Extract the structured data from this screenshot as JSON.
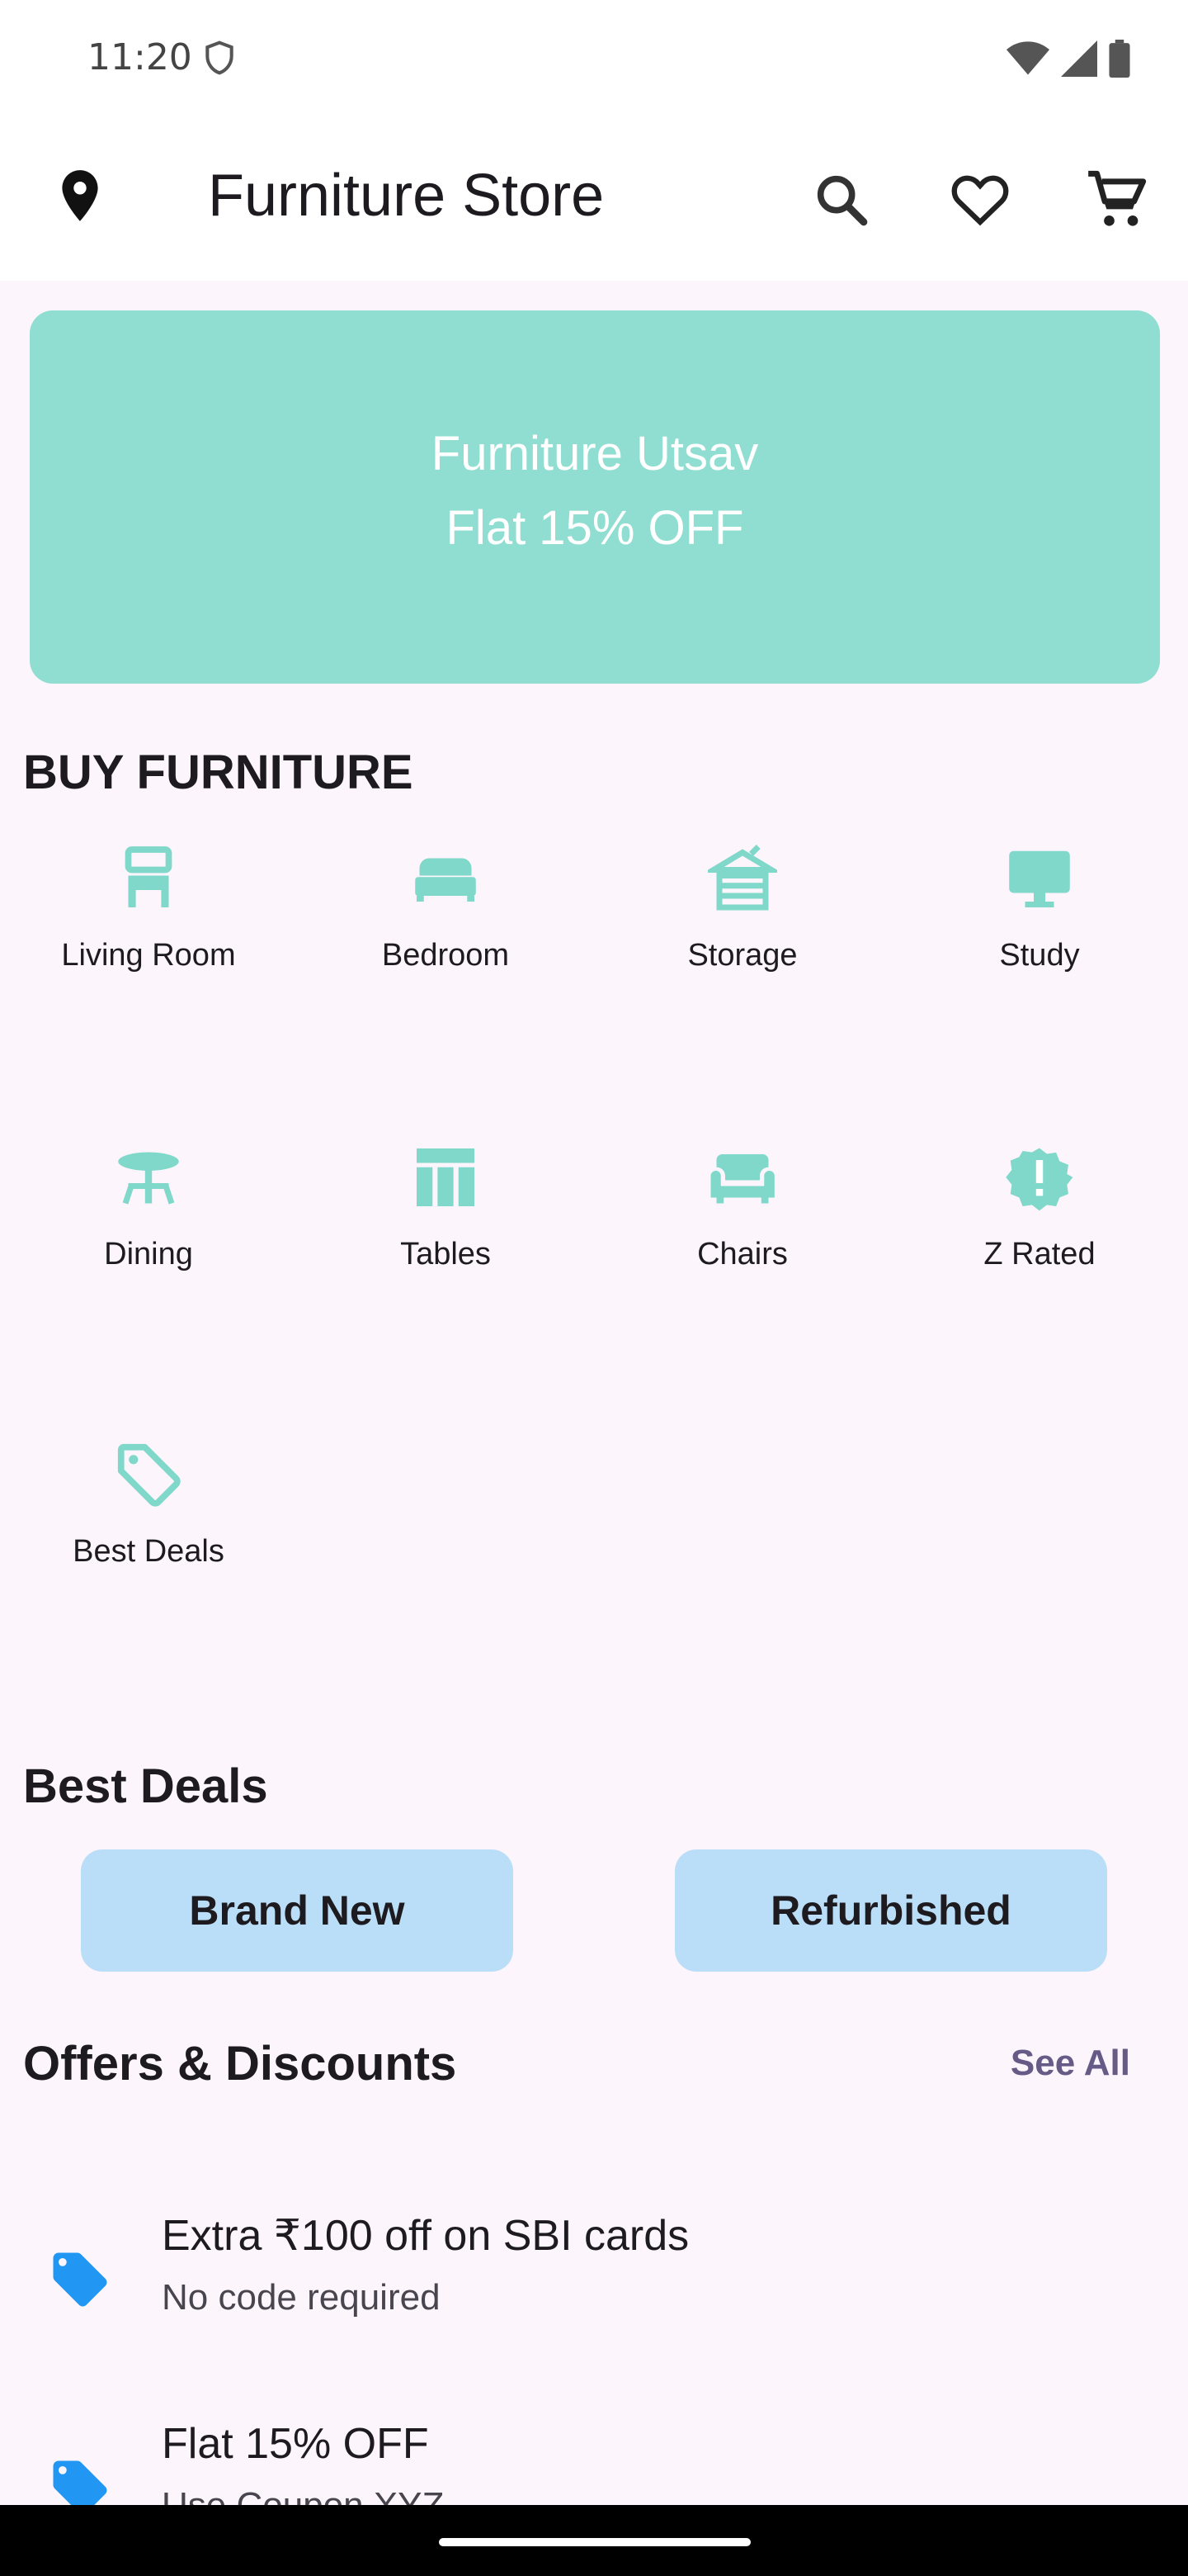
{
  "status": {
    "time": "11:20"
  },
  "appbar": {
    "title": "Furniture Store"
  },
  "banner": {
    "line1": "Furniture Utsav",
    "line2": "Flat 15% OFF"
  },
  "categories_title": "BUY FURNITURE",
  "categories": [
    {
      "label": "Living Room",
      "icon": "living-room-icon"
    },
    {
      "label": "Bedroom",
      "icon": "bed-icon"
    },
    {
      "label": "Storage",
      "icon": "storage-icon"
    },
    {
      "label": "Study",
      "icon": "desktop-icon"
    },
    {
      "label": "Dining",
      "icon": "dining-table-icon"
    },
    {
      "label": "Tables",
      "icon": "table-icon"
    },
    {
      "label": "Chairs",
      "icon": "armchair-icon"
    },
    {
      "label": "Z Rated",
      "icon": "alert-badge-icon"
    },
    {
      "label": "Best Deals",
      "icon": "price-tag-icon"
    }
  ],
  "best_deals": {
    "title": "Best Deals",
    "brand_new": "Brand New",
    "refurbished": "Refurbished"
  },
  "offers": {
    "title": "Offers & Discounts",
    "see_all": "See All",
    "items": [
      {
        "title": "Extra ₹100 off on SBI cards",
        "subtitle": "No code required"
      },
      {
        "title": "Flat 15% OFF",
        "subtitle": "Use Coupon XYZ"
      }
    ]
  },
  "colors": {
    "accent": "#90ded1",
    "chip": "#bbdef8",
    "tag": "#2196f3",
    "link": "#655b86",
    "background": "#fcf5fc"
  }
}
